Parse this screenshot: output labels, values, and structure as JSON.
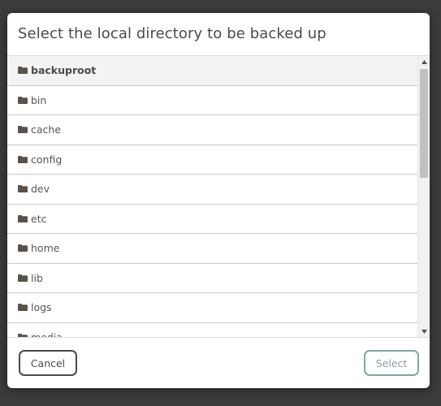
{
  "dialog": {
    "title": "Select the local directory to be backed up"
  },
  "directories": [
    {
      "label": "backuproot",
      "is_root": true
    },
    {
      "label": "bin"
    },
    {
      "label": "cache"
    },
    {
      "label": "config"
    },
    {
      "label": "dev"
    },
    {
      "label": "etc"
    },
    {
      "label": "home"
    },
    {
      "label": "lib"
    },
    {
      "label": "logs"
    },
    {
      "label": "media"
    }
  ],
  "icons": {
    "folder": "folder-icon",
    "scroll_up": "scroll-up-arrow-icon",
    "scroll_down": "scroll-down-arrow-icon"
  },
  "footer": {
    "cancel_label": "Cancel",
    "select_label": "Select"
  },
  "colors": {
    "backdrop": "#3b3b3b",
    "folder_icon": "#5a5249",
    "select_border": "#7fa6aa",
    "cancel_border": "#4a4a4a"
  }
}
